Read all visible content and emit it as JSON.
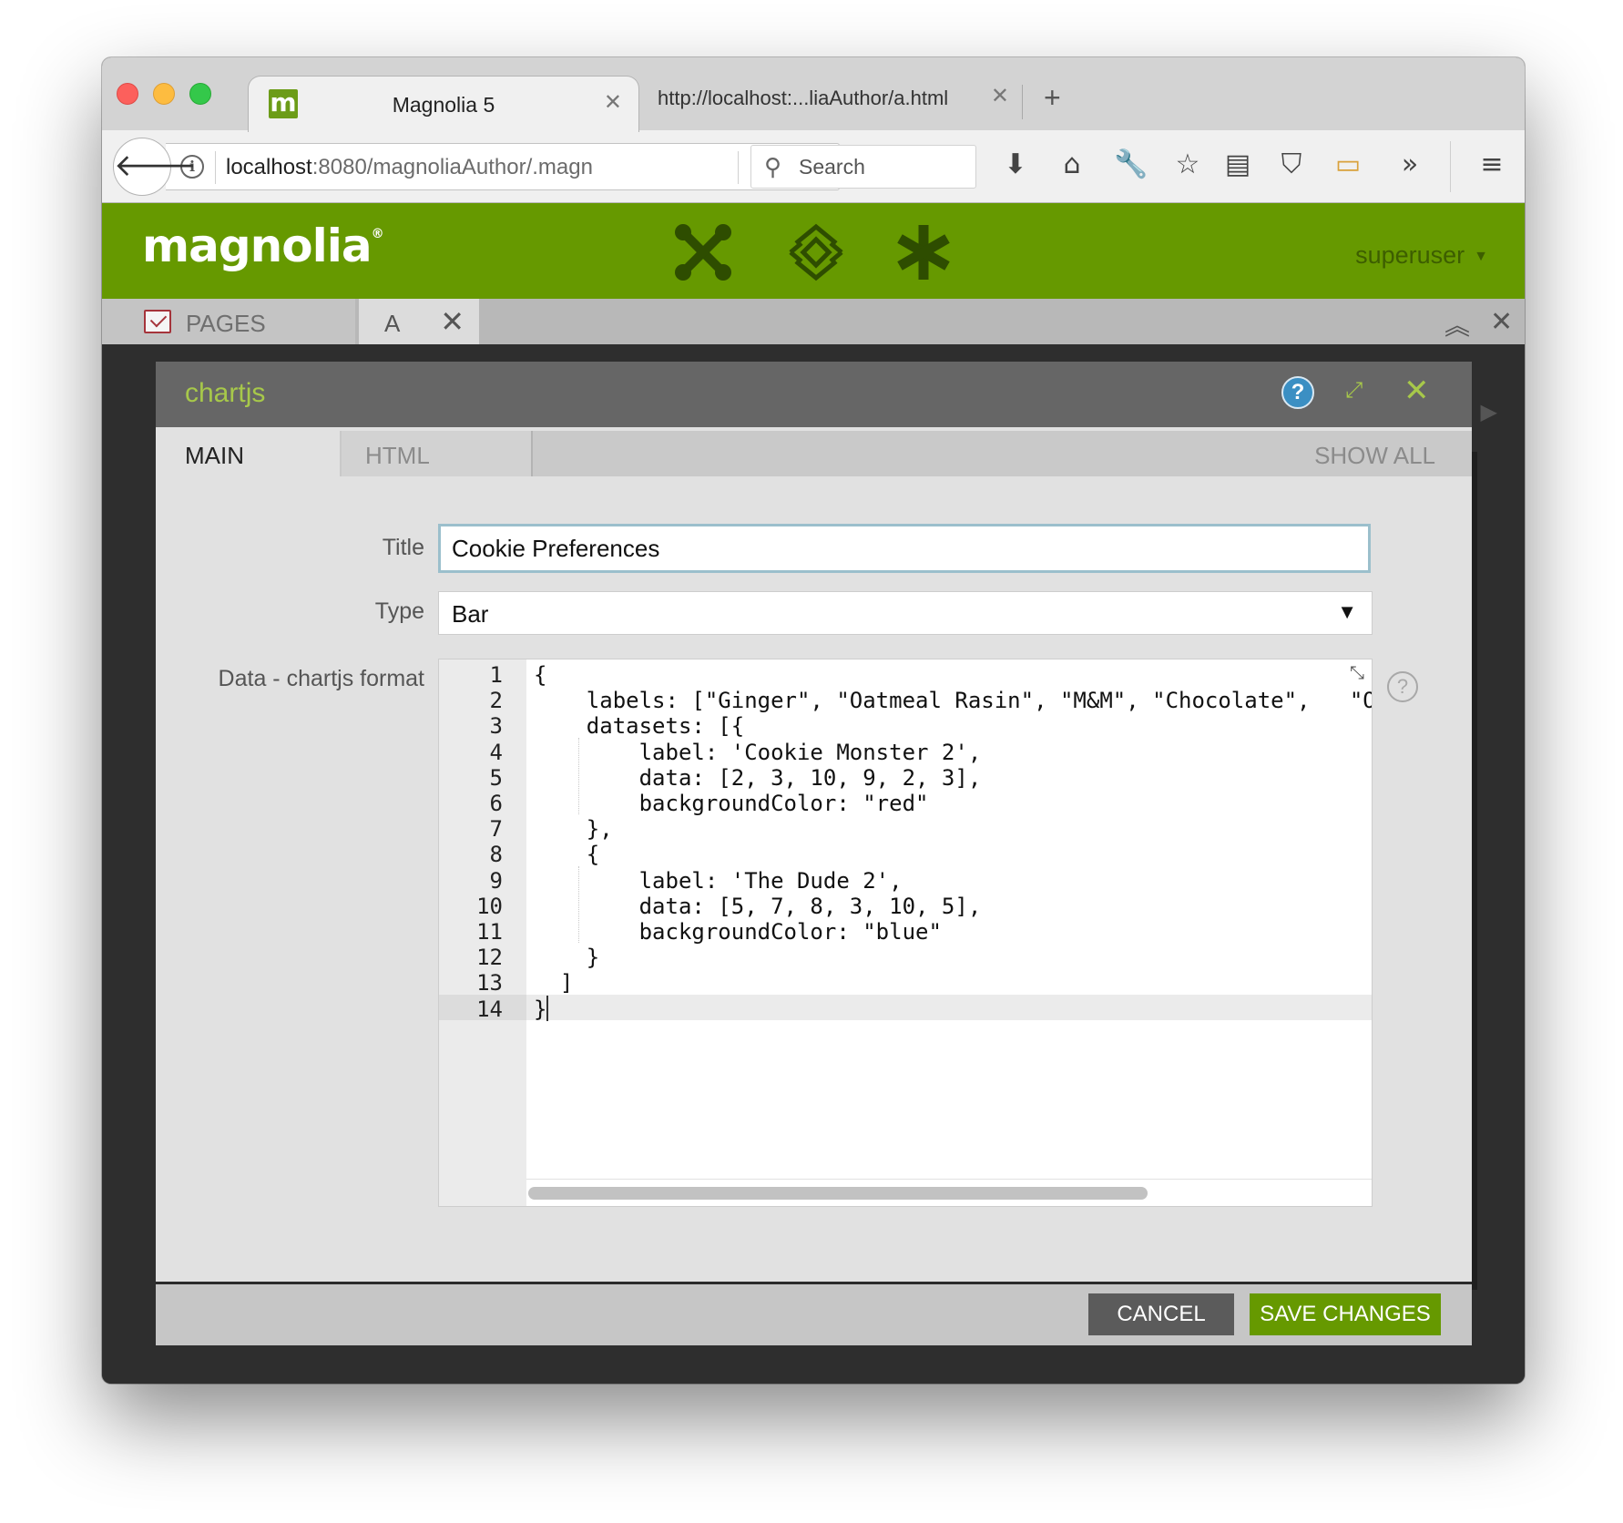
{
  "browser": {
    "tabs": [
      {
        "title": "Magnolia 5",
        "favicon": "m"
      },
      {
        "title": "http://localhost:...liaAuthor/a.html"
      }
    ],
    "url_host": "localhost",
    "url_rest": ":8080/magnoliaAuthor/.magn",
    "search_placeholder": "Search",
    "toolbar_icons": [
      "download-icon",
      "home-icon",
      "wrench-icon",
      "star-icon",
      "reading-list-icon",
      "pocket-icon",
      "screenshot-icon",
      "overflow-icon",
      "menu-icon"
    ]
  },
  "magnolia": {
    "logo": "magnolia",
    "logo_mark": "®",
    "user": "superuser",
    "app_tabs": {
      "pages": "PAGES",
      "current": "A"
    },
    "colors": {
      "brand_green": "#669900",
      "accent_green": "#a7c84a"
    }
  },
  "dialog": {
    "title": "chartjs",
    "tabs": {
      "main": "MAIN",
      "html": "HTML",
      "show_all": "SHOW ALL"
    },
    "fields": {
      "title_label": "Title",
      "title_value": "Cookie Preferences",
      "type_label": "Type",
      "type_value": "Bar",
      "data_label": "Data - chartjs format"
    },
    "code_lines": [
      "{",
      "    labels: [\"Ginger\", \"Oatmeal Rasin\", \"M&M\", \"Chocolate\",   \"Or",
      "    datasets: [{",
      "        label: 'Cookie Monster 2',",
      "        data: [2, 3, 10, 9, 2, 3],",
      "        backgroundColor: \"red\"",
      "    },",
      "    {",
      "        label: 'The Dude 2',",
      "        data: [5, 7, 8, 3, 10, 5],",
      "        backgroundColor: \"blue\"",
      "    }",
      "  ]",
      "}"
    ],
    "line_numbers": [
      "1",
      "2",
      "3",
      "4",
      "5",
      "6",
      "7",
      "8",
      "9",
      "10",
      "11",
      "12",
      "13",
      "14"
    ],
    "buttons": {
      "cancel": "CANCEL",
      "save": "SAVE CHANGES"
    }
  }
}
